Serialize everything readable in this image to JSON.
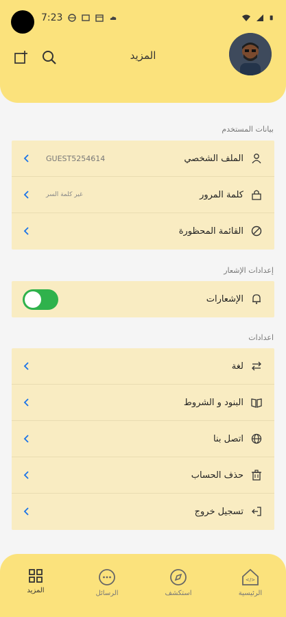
{
  "status": {
    "time": "7:23"
  },
  "header": {
    "title": "المزيد",
    "avatar_icon": "user-avatar"
  },
  "sections": {
    "user_data": {
      "title": "بيانات المستخدم",
      "items": [
        {
          "label": "الملف الشخصي",
          "value": "GUEST5254614",
          "icon": "user-icon"
        },
        {
          "label": "كلمة المرور",
          "value": "غير كلمة السر",
          "icon": "lock-icon"
        },
        {
          "label": "القائمة المحظورة",
          "value": "",
          "icon": "block-icon"
        }
      ]
    },
    "notification_settings": {
      "title": "إعدادات الإشعار",
      "items": [
        {
          "label": "الإشعارات",
          "icon": "bell-icon",
          "toggle_on": true
        }
      ]
    },
    "settings": {
      "title": "اعدادات",
      "items": [
        {
          "label": "لغة",
          "icon": "swap-icon"
        },
        {
          "label": "البنود و الشروط",
          "icon": "book-icon"
        },
        {
          "label": "اتصل بنا",
          "icon": "globe-icon"
        },
        {
          "label": "حذف الحساب",
          "icon": "trash-icon"
        },
        {
          "label": "تسجيل خروج",
          "icon": "logout-icon"
        }
      ]
    }
  },
  "bottom_nav": {
    "items": [
      {
        "label": "الرئيسية",
        "icon": "home-icon"
      },
      {
        "label": "استكشف",
        "icon": "compass-icon"
      },
      {
        "label": "الرسائل",
        "icon": "chat-icon"
      },
      {
        "label": "المزيد",
        "icon": "grid-icon",
        "active": true
      }
    ]
  },
  "colors": {
    "accent": "#fbe27c",
    "card": "#f9ecc2",
    "toggle_on": "#2fb24c",
    "chevron": "#1a73e8"
  }
}
